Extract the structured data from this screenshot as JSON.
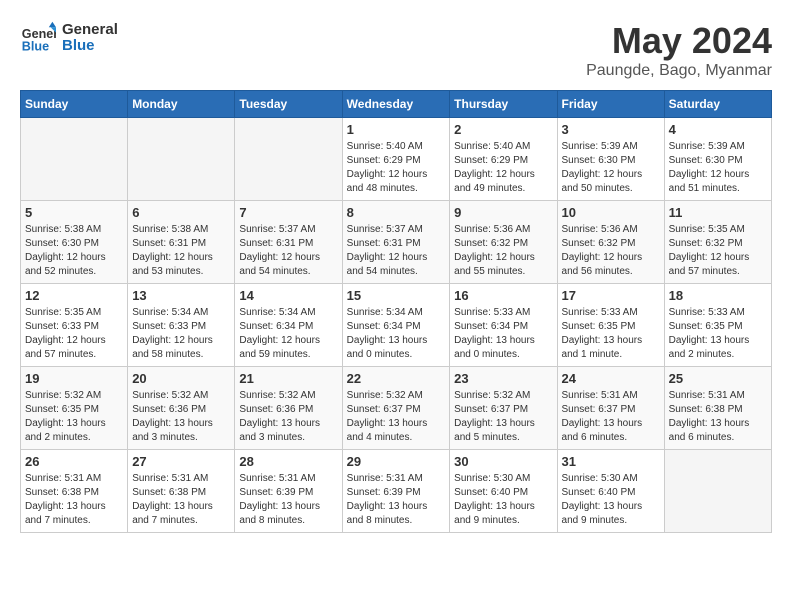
{
  "logo": {
    "line1": "General",
    "line2": "Blue"
  },
  "title": "May 2024",
  "location": "Paungde, Bago, Myanmar",
  "weekdays": [
    "Sunday",
    "Monday",
    "Tuesday",
    "Wednesday",
    "Thursday",
    "Friday",
    "Saturday"
  ],
  "weeks": [
    [
      {
        "day": "",
        "info": ""
      },
      {
        "day": "",
        "info": ""
      },
      {
        "day": "",
        "info": ""
      },
      {
        "day": "1",
        "info": "Sunrise: 5:40 AM\nSunset: 6:29 PM\nDaylight: 12 hours\nand 48 minutes."
      },
      {
        "day": "2",
        "info": "Sunrise: 5:40 AM\nSunset: 6:29 PM\nDaylight: 12 hours\nand 49 minutes."
      },
      {
        "day": "3",
        "info": "Sunrise: 5:39 AM\nSunset: 6:30 PM\nDaylight: 12 hours\nand 50 minutes."
      },
      {
        "day": "4",
        "info": "Sunrise: 5:39 AM\nSunset: 6:30 PM\nDaylight: 12 hours\nand 51 minutes."
      }
    ],
    [
      {
        "day": "5",
        "info": "Sunrise: 5:38 AM\nSunset: 6:30 PM\nDaylight: 12 hours\nand 52 minutes."
      },
      {
        "day": "6",
        "info": "Sunrise: 5:38 AM\nSunset: 6:31 PM\nDaylight: 12 hours\nand 53 minutes."
      },
      {
        "day": "7",
        "info": "Sunrise: 5:37 AM\nSunset: 6:31 PM\nDaylight: 12 hours\nand 54 minutes."
      },
      {
        "day": "8",
        "info": "Sunrise: 5:37 AM\nSunset: 6:31 PM\nDaylight: 12 hours\nand 54 minutes."
      },
      {
        "day": "9",
        "info": "Sunrise: 5:36 AM\nSunset: 6:32 PM\nDaylight: 12 hours\nand 55 minutes."
      },
      {
        "day": "10",
        "info": "Sunrise: 5:36 AM\nSunset: 6:32 PM\nDaylight: 12 hours\nand 56 minutes."
      },
      {
        "day": "11",
        "info": "Sunrise: 5:35 AM\nSunset: 6:32 PM\nDaylight: 12 hours\nand 57 minutes."
      }
    ],
    [
      {
        "day": "12",
        "info": "Sunrise: 5:35 AM\nSunset: 6:33 PM\nDaylight: 12 hours\nand 57 minutes."
      },
      {
        "day": "13",
        "info": "Sunrise: 5:34 AM\nSunset: 6:33 PM\nDaylight: 12 hours\nand 58 minutes."
      },
      {
        "day": "14",
        "info": "Sunrise: 5:34 AM\nSunset: 6:34 PM\nDaylight: 12 hours\nand 59 minutes."
      },
      {
        "day": "15",
        "info": "Sunrise: 5:34 AM\nSunset: 6:34 PM\nDaylight: 13 hours\nand 0 minutes."
      },
      {
        "day": "16",
        "info": "Sunrise: 5:33 AM\nSunset: 6:34 PM\nDaylight: 13 hours\nand 0 minutes."
      },
      {
        "day": "17",
        "info": "Sunrise: 5:33 AM\nSunset: 6:35 PM\nDaylight: 13 hours\nand 1 minute."
      },
      {
        "day": "18",
        "info": "Sunrise: 5:33 AM\nSunset: 6:35 PM\nDaylight: 13 hours\nand 2 minutes."
      }
    ],
    [
      {
        "day": "19",
        "info": "Sunrise: 5:32 AM\nSunset: 6:35 PM\nDaylight: 13 hours\nand 2 minutes."
      },
      {
        "day": "20",
        "info": "Sunrise: 5:32 AM\nSunset: 6:36 PM\nDaylight: 13 hours\nand 3 minutes."
      },
      {
        "day": "21",
        "info": "Sunrise: 5:32 AM\nSunset: 6:36 PM\nDaylight: 13 hours\nand 3 minutes."
      },
      {
        "day": "22",
        "info": "Sunrise: 5:32 AM\nSunset: 6:37 PM\nDaylight: 13 hours\nand 4 minutes."
      },
      {
        "day": "23",
        "info": "Sunrise: 5:32 AM\nSunset: 6:37 PM\nDaylight: 13 hours\nand 5 minutes."
      },
      {
        "day": "24",
        "info": "Sunrise: 5:31 AM\nSunset: 6:37 PM\nDaylight: 13 hours\nand 6 minutes."
      },
      {
        "day": "25",
        "info": "Sunrise: 5:31 AM\nSunset: 6:38 PM\nDaylight: 13 hours\nand 6 minutes."
      }
    ],
    [
      {
        "day": "26",
        "info": "Sunrise: 5:31 AM\nSunset: 6:38 PM\nDaylight: 13 hours\nand 7 minutes."
      },
      {
        "day": "27",
        "info": "Sunrise: 5:31 AM\nSunset: 6:38 PM\nDaylight: 13 hours\nand 7 minutes."
      },
      {
        "day": "28",
        "info": "Sunrise: 5:31 AM\nSunset: 6:39 PM\nDaylight: 13 hours\nand 8 minutes."
      },
      {
        "day": "29",
        "info": "Sunrise: 5:31 AM\nSunset: 6:39 PM\nDaylight: 13 hours\nand 8 minutes."
      },
      {
        "day": "30",
        "info": "Sunrise: 5:30 AM\nSunset: 6:40 PM\nDaylight: 13 hours\nand 9 minutes."
      },
      {
        "day": "31",
        "info": "Sunrise: 5:30 AM\nSunset: 6:40 PM\nDaylight: 13 hours\nand 9 minutes."
      },
      {
        "day": "",
        "info": ""
      }
    ]
  ]
}
